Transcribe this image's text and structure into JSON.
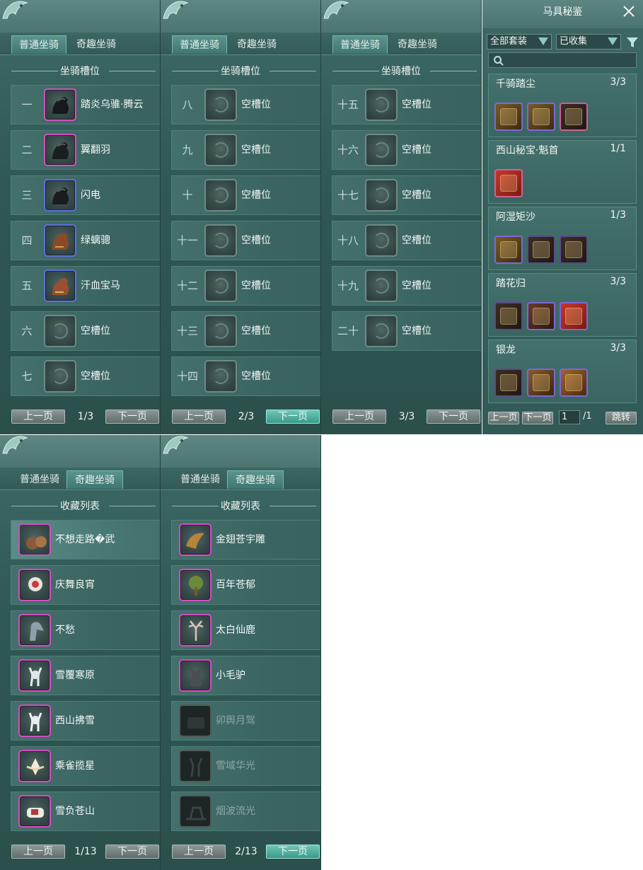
{
  "tabs": {
    "normal": "普通坐骑",
    "fun": "奇趣坐骑"
  },
  "headings": {
    "slots": "坐骑槽位",
    "collection": "收藏列表"
  },
  "pager": {
    "prev": "上一页",
    "next": "下一页"
  },
  "panel1": {
    "rows": [
      {
        "num": "一",
        "name": "踏炎乌骓·腾云"
      },
      {
        "num": "二",
        "name": "翼翻羽"
      },
      {
        "num": "三",
        "name": "闪电"
      },
      {
        "num": "四",
        "name": "绿螭骢"
      },
      {
        "num": "五",
        "name": "汗血宝马"
      },
      {
        "num": "六",
        "name": "空槽位"
      },
      {
        "num": "七",
        "name": "空槽位"
      }
    ],
    "page": "1/3"
  },
  "panel2": {
    "rows": [
      {
        "num": "八",
        "name": "空槽位"
      },
      {
        "num": "九",
        "name": "空槽位"
      },
      {
        "num": "十",
        "name": "空槽位"
      },
      {
        "num": "十一",
        "name": "空槽位"
      },
      {
        "num": "十二",
        "name": "空槽位"
      },
      {
        "num": "十三",
        "name": "空槽位"
      },
      {
        "num": "十四",
        "name": "空槽位"
      }
    ],
    "page": "2/3"
  },
  "panel3": {
    "rows": [
      {
        "num": "十五",
        "name": "空槽位"
      },
      {
        "num": "十六",
        "name": "空槽位"
      },
      {
        "num": "十七",
        "name": "空槽位"
      },
      {
        "num": "十八",
        "name": "空槽位"
      },
      {
        "num": "十九",
        "name": "空槽位"
      },
      {
        "num": "二十",
        "name": "空槽位"
      }
    ],
    "page": "3/3"
  },
  "panel4": {
    "rows": [
      {
        "name": "不想走路�武"
      },
      {
        "name": "庆舞良宵"
      },
      {
        "name": "不愁"
      },
      {
        "name": "雪覆寒原"
      },
      {
        "name": "西山拂雪"
      },
      {
        "name": "乘雀揽星"
      },
      {
        "name": "雪负苍山"
      }
    ],
    "page": "1/13"
  },
  "panel5": {
    "rows": [
      {
        "name": "金翅苍宇雕"
      },
      {
        "name": "百年苍郁"
      },
      {
        "name": "太白仙鹿"
      },
      {
        "name": "小毛驴"
      },
      {
        "name": "卯舆月驾"
      },
      {
        "name": "雪域华光"
      },
      {
        "name": "烟波流光"
      }
    ],
    "page": "2/13"
  },
  "codex": {
    "title": "马具秘鉴",
    "filter_set": "全部套装",
    "filter_status": "已收集",
    "sets": [
      {
        "name": "千骑踏尘",
        "count": "3/3"
      },
      {
        "name": "西山秘宝·魁首",
        "count": "1/1"
      },
      {
        "name": "阿湿矩沙",
        "count": "1/3"
      },
      {
        "name": "踏花归",
        "count": "3/3"
      },
      {
        "name": "银龙",
        "count": "3/3"
      }
    ],
    "prev": "上一页",
    "next": "下一页",
    "page_input": "1",
    "page_total": "/1",
    "jump": "跳转"
  },
  "colors": {
    "panel_bg": "#2f5754",
    "tab_active": "#4f8a84",
    "button_next": "#3a9a8b",
    "slot_magenta": "#d04fbf",
    "slot_blue": "#5f6ed8"
  }
}
